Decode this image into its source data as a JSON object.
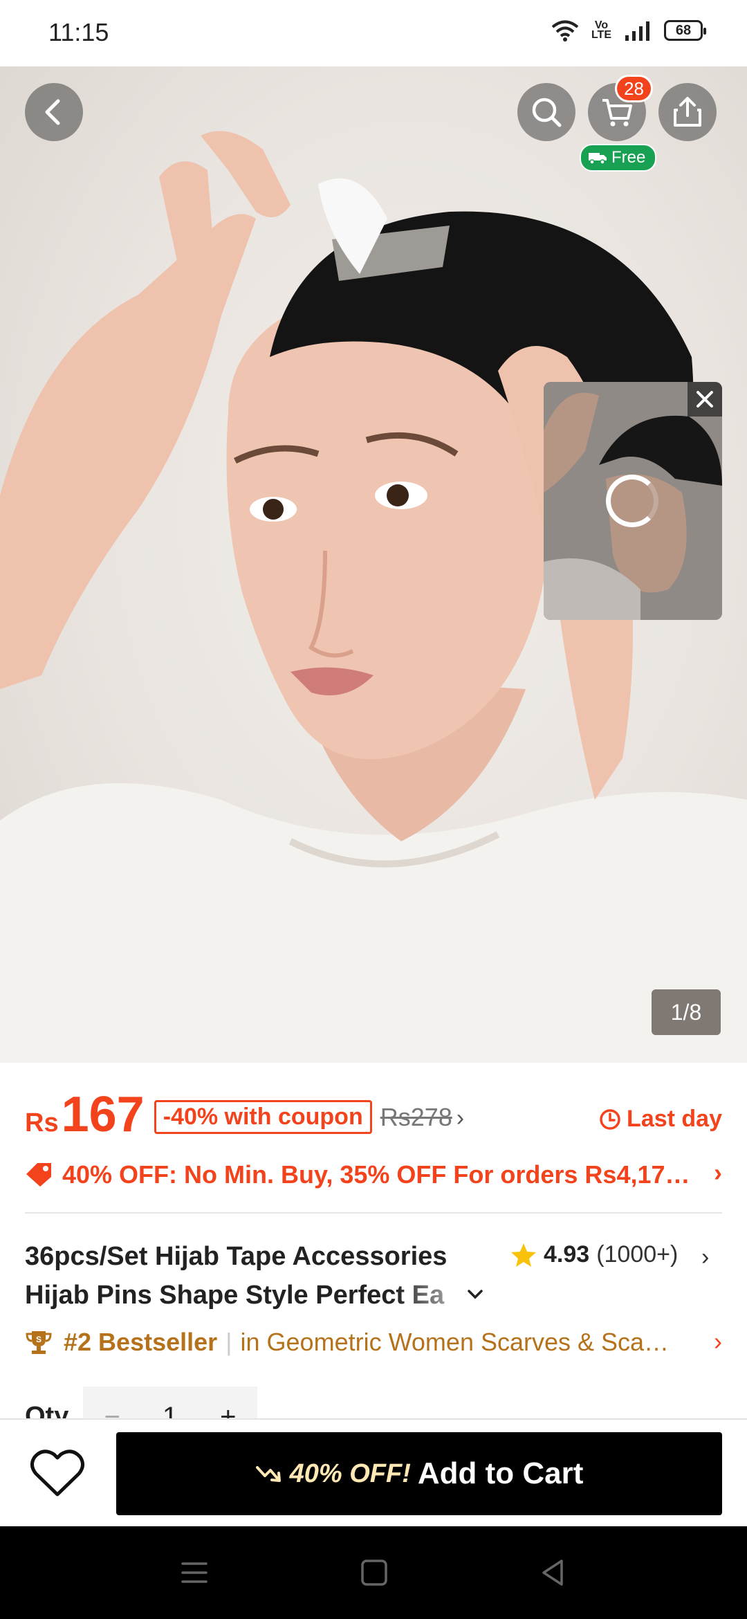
{
  "status_bar": {
    "time": "11:15",
    "volte": "Vo\nLTE",
    "battery": "68"
  },
  "gallery": {
    "counter": "1/8",
    "cart_count": "28",
    "free_shipping": "Free"
  },
  "price": {
    "currency": "Rs",
    "amount": "167",
    "coupon": "-40% with coupon",
    "original": "Rs278",
    "last_day": "Last day"
  },
  "promo": {
    "text": "40% OFF: No Min. Buy,  35% OFF For orders Rs4,17…"
  },
  "product": {
    "title_line1": "36pcs/Set Hijab Tape Accessories",
    "title_line2": "Hijab Pins Shape Style Perfect Ea",
    "rating": "4.93",
    "rating_count": "(1000+)"
  },
  "bestseller": {
    "rank": "#2 Bestseller",
    "category": "in Geometric Women Scarves & Sca…"
  },
  "quantity": {
    "label": "Qty",
    "minus": "−",
    "value": "1",
    "plus": "+"
  },
  "actions": {
    "cart_promo": "40% OFF!",
    "cart_label": "Add to Cart"
  },
  "colors": {
    "accent": "#f3431d",
    "bestseller": "#b5721a",
    "free_green": "#18a053"
  }
}
